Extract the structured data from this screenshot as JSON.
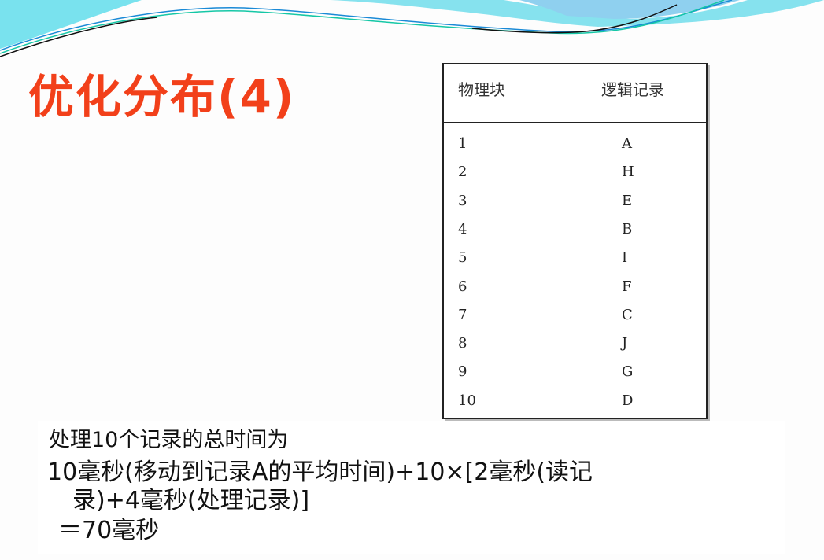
{
  "slide": {
    "title": "优化分布(4)",
    "table": {
      "headers": [
        "物理块",
        "逻辑记录"
      ],
      "rows": [
        [
          "1",
          "A"
        ],
        [
          "2",
          "H"
        ],
        [
          "3",
          "E"
        ],
        [
          "4",
          "B"
        ],
        [
          "5",
          "I"
        ],
        [
          "6",
          "F"
        ],
        [
          "7",
          "C"
        ],
        [
          "8",
          "J"
        ],
        [
          "9",
          "G"
        ],
        [
          "10",
          "D"
        ]
      ]
    },
    "text": {
      "line1": "处理10个记录的总时间为",
      "line2": "10毫秒(移动到记录A的平均时间)+10×[2毫秒(读记",
      "line3": "录)+4毫秒(处理记录)]",
      "line4": "＝70毫秒"
    },
    "colors": {
      "title": "#f2401a",
      "wave": "#7fe3ee"
    }
  }
}
